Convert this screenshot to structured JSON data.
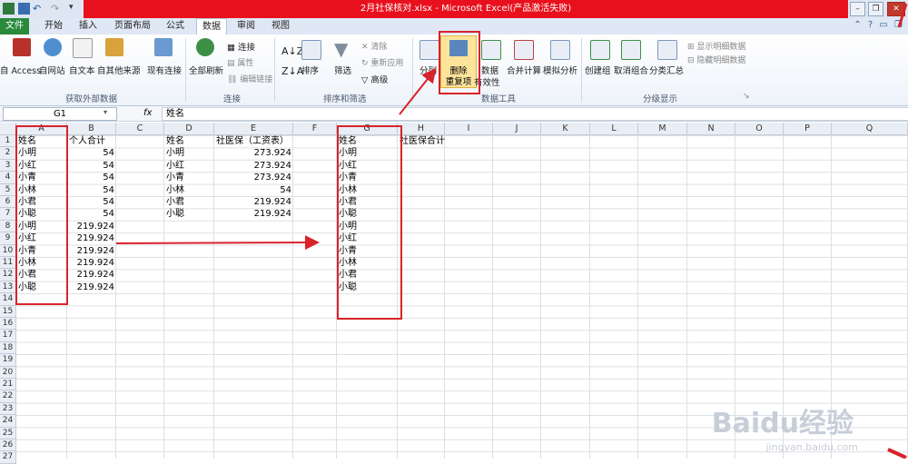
{
  "title": "2月社保核对.xlsx - Microsoft Excel(产品激活失败)",
  "tabs": [
    {
      "label": "文件",
      "kind": "file"
    },
    {
      "label": "开始"
    },
    {
      "label": "插入"
    },
    {
      "label": "页面布局"
    },
    {
      "label": "公式"
    },
    {
      "label": "数据",
      "active": true
    },
    {
      "label": "审阅"
    },
    {
      "label": "视图"
    }
  ],
  "ribbon": {
    "get_external": {
      "access": "自 Access",
      "web": "自网站",
      "text": "自文本",
      "other": "自其他来源",
      "existing": "现有连接",
      "label": "获取外部数据"
    },
    "connections": {
      "refresh": "全部刷新",
      "connect": "连接",
      "props": "属性",
      "edit": "编辑链接",
      "label": "连接"
    },
    "sort_filter": {
      "sort": "排序",
      "filter": "筛选",
      "clear": "清除",
      "reapply": "重新应用",
      "advanced": "高级",
      "label": "排序和筛选"
    },
    "data_tools": {
      "split": "分列",
      "remove_dup_1": "删除",
      "remove_dup_2": "重复项",
      "validation_1": "数据",
      "validation_2": "有效性",
      "consolidate": "合并计算",
      "whatif": "模拟分析",
      "label": "数据工具"
    },
    "outline": {
      "group": "创建组",
      "ungroup": "取消组合",
      "subtotal": "分类汇总",
      "show": "显示明细数据",
      "hide": "隐藏明细数据",
      "label": "分级显示"
    }
  },
  "formula_bar": {
    "namebox": "G1",
    "fx": "fx",
    "formula": "姓名"
  },
  "columns": [
    "A",
    "B",
    "C",
    "D",
    "E",
    "F",
    "G",
    "H",
    "I",
    "J",
    "K",
    "L",
    "M",
    "N",
    "O",
    "P",
    "Q"
  ],
  "rows": [
    "1",
    "2",
    "3",
    "4",
    "5",
    "6",
    "7",
    "8",
    "9",
    "10",
    "11",
    "12",
    "13",
    "14",
    "15",
    "16",
    "17",
    "18",
    "19",
    "20",
    "21",
    "22",
    "23",
    "24",
    "25",
    "26",
    "27"
  ],
  "cells": {
    "A": [
      "姓名",
      "小明",
      "小红",
      "小青",
      "小林",
      "小君",
      "小聪",
      "小明",
      "小红",
      "小青",
      "小林",
      "小君",
      "小聪"
    ],
    "B": [
      "个人合计",
      "54",
      "54",
      "54",
      "54",
      "54",
      "54",
      "219.924",
      "219.924",
      "219.924",
      "219.924",
      "219.924",
      "219.924"
    ],
    "D": [
      "姓名",
      "小明",
      "小红",
      "小青",
      "小林",
      "小君",
      "小聪"
    ],
    "E": [
      "社医保（工资表）",
      "273.924",
      "273.924",
      "273.924",
      "54",
      "219.924",
      "219.924"
    ],
    "G": [
      "姓名",
      "小明",
      "小红",
      "小青",
      "小林",
      "小君",
      "小聪",
      "小明",
      "小红",
      "小青",
      "小林",
      "小君",
      "小聪"
    ],
    "H": [
      "社医保合计"
    ]
  },
  "watermark": {
    "main": "Baidu经验",
    "sub": "jingyan.baidu.com"
  },
  "colors": {
    "accent_red": "#d8232a",
    "title_red": "#e8101c",
    "file_green": "#2a8a3c"
  }
}
